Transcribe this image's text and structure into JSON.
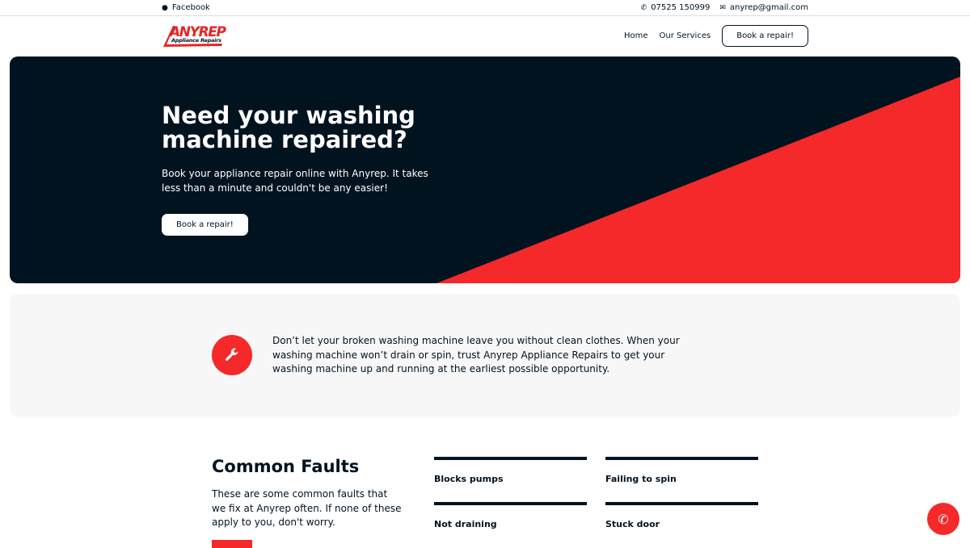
{
  "topbar": {
    "facebook": "Facebook",
    "phone": "07525 150999",
    "email": "anyrep@gmail.com"
  },
  "logo": {
    "name": "ANYREP",
    "tagline": "Appliance Repairs"
  },
  "nav": {
    "home": "Home",
    "services": "Our Services",
    "book": "Book a repair!"
  },
  "hero": {
    "title": "Need your washing machine repaired?",
    "subtitle": "Book your appliance repair online with Anyrep. It takes less than a minute and couldn't be any easier!",
    "cta": "Book a repair!"
  },
  "intro": {
    "text": "Don’t let your broken washing machine leave you without clean clothes. When your washing machine won’t drain or spin, trust Anyrep Appliance Repairs to get your washing machine up and running at the earliest possible opportunity."
  },
  "faults": {
    "title": "Common Faults",
    "description": "These are some common faults that we fix at Anyrep often. If none of these apply to you, don't worry.",
    "items": [
      "Blocks pumps",
      "Failing to spin",
      "Not draining",
      "Stuck door"
    ]
  },
  "colors": {
    "accent": "#f52929",
    "dark": "#021320"
  }
}
